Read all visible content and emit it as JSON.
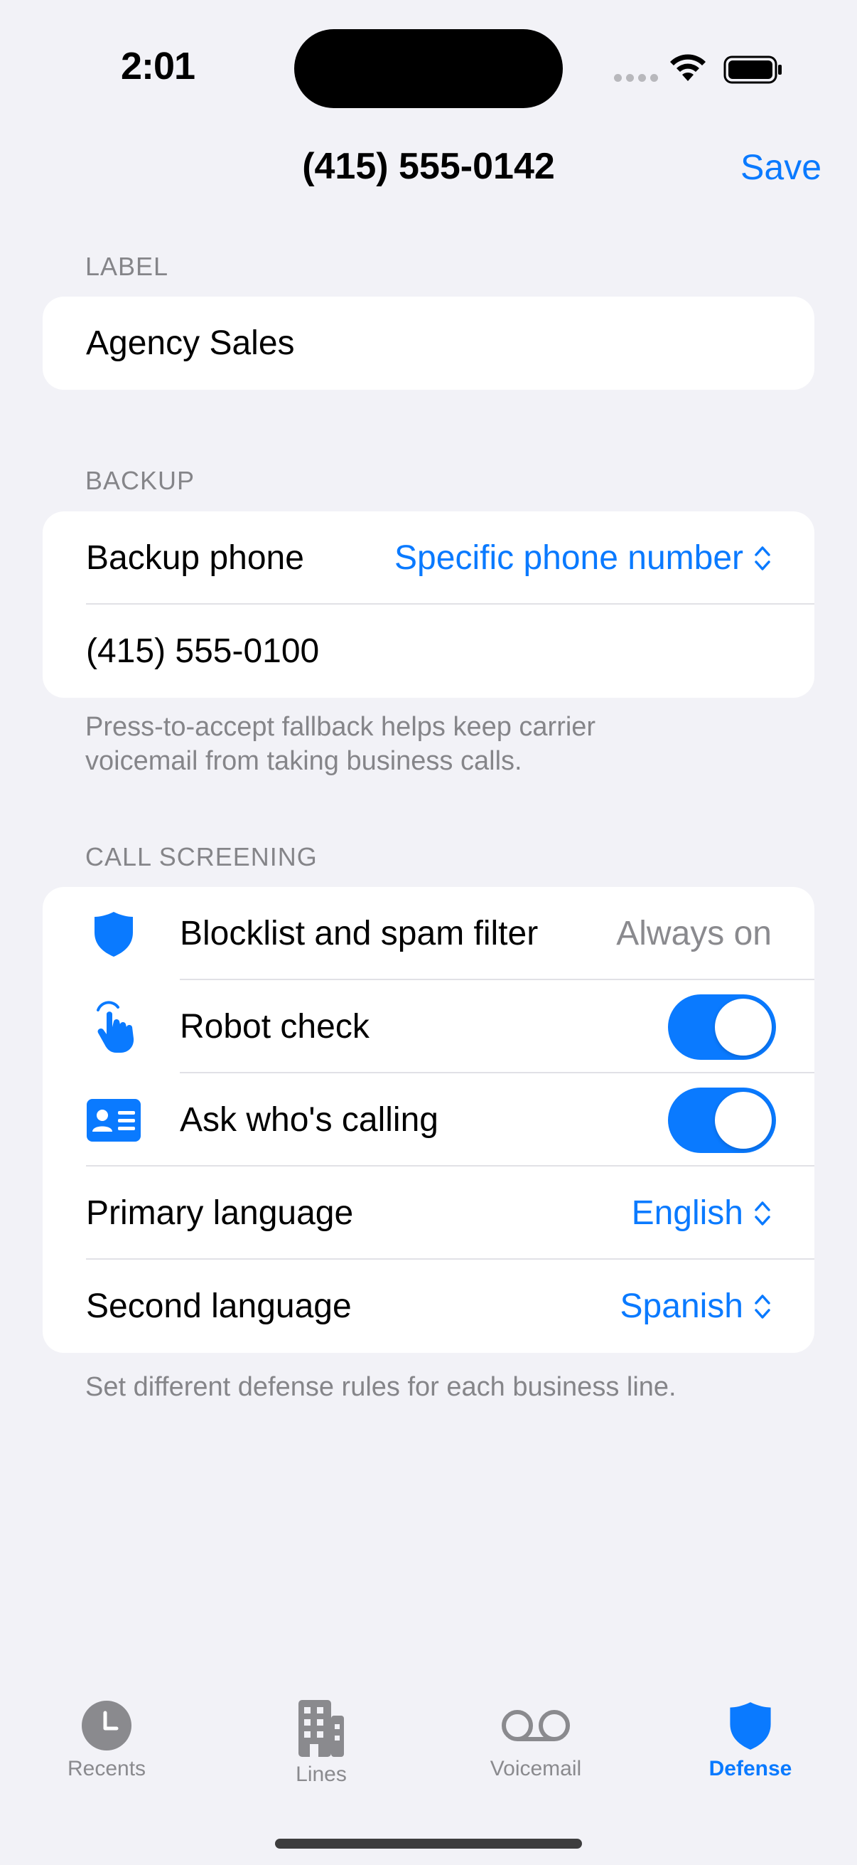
{
  "status_bar": {
    "time": "2:01"
  },
  "nav": {
    "title": "(415) 555-0142",
    "save_label": "Save"
  },
  "label_section": {
    "header": "LABEL",
    "value": "Agency Sales"
  },
  "backup_section": {
    "header": "BACKUP",
    "backup_phone_label": "Backup phone",
    "backup_phone_value": "Specific phone number",
    "phone_number": "(415) 555-0100",
    "footer_line1": "Press-to-accept fallback helps keep carrier",
    "footer_line2": "voicemail from taking business calls."
  },
  "screening_section": {
    "header": "CALL SCREENING",
    "blocklist_label": "Blocklist and spam filter",
    "blocklist_value": "Always on",
    "robot_label": "Robot check",
    "robot_enabled": true,
    "ask_label": "Ask who's calling",
    "ask_enabled": true,
    "primary_language_label": "Primary language",
    "primary_language_value": "English",
    "second_language_label": "Second language",
    "second_language_value": "Spanish",
    "footer": "Set different defense rules for each business line."
  },
  "tabs": [
    {
      "label": "Recents",
      "icon": "clock-icon",
      "active": false
    },
    {
      "label": "Lines",
      "icon": "building-icon",
      "active": false
    },
    {
      "label": "Voicemail",
      "icon": "voicemail-icon",
      "active": false
    },
    {
      "label": "Defense",
      "icon": "shield-icon",
      "active": true
    }
  ],
  "colors": {
    "accent": "#0a7aff",
    "background": "#f2f2f7",
    "secondary_text": "#858589"
  }
}
